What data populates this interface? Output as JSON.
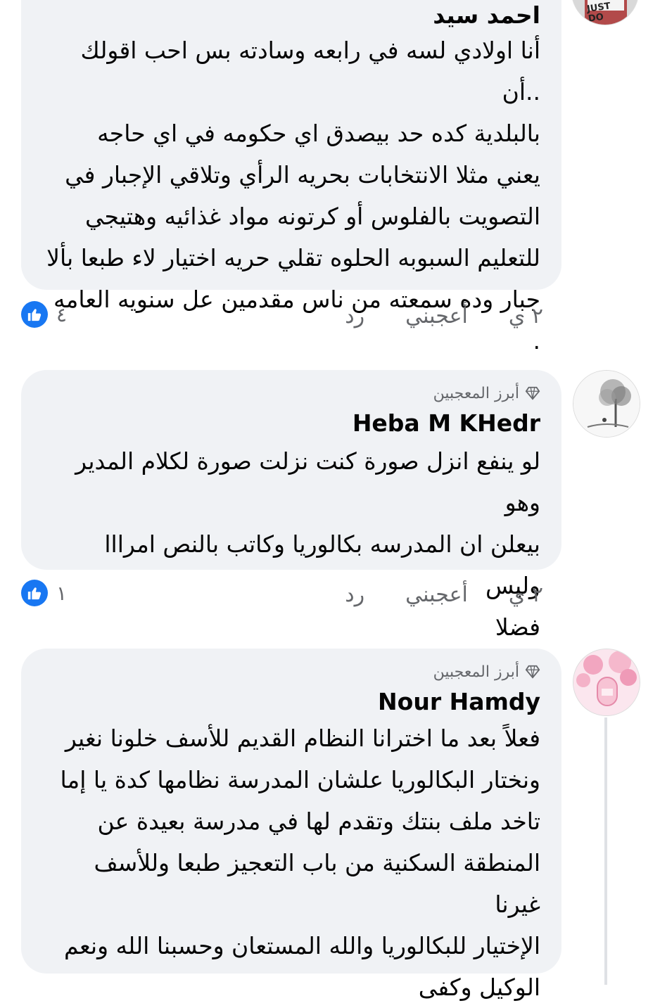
{
  "comments": [
    {
      "author": "احمد سيد",
      "top_fan_label": "",
      "avatar_text": "JUST DO",
      "lines": [
        "أنا اولادي لسه في رابعه وسادته بس احب اقولك ..أن",
        "بالبلدية كده حد بيصدق اي حكومه في اي حاجه",
        "يعني مثلا الانتخابات بحريه الرأي وتلاقي الإجبار في",
        "التصويت بالفلوس أو كرتونه مواد غذائيه وهتيجي",
        "للتعليم السبوبه الحلوه تقلي حريه اختيار لاء طبعا بألا",
        "جبار وده سمعته من ناس مقدمين عل سنويه العامه ."
      ],
      "time": "٢ ي",
      "like_label": "أعجبني",
      "reply_label": "رد",
      "reaction_count": "٤"
    },
    {
      "author": "Heba M KHedr",
      "top_fan_label": "أبرز المعجبين",
      "lines": [
        "لو ينفع انزل صورة كنت نزلت صورة لكلام المدير وهو",
        "بيعلن ان المدرسه بكالوريا وكاتب بالنص امرااا وليس",
        "فضلا"
      ],
      "time": "٢ ي",
      "like_label": "أعجبني",
      "reply_label": "رد",
      "reaction_count": "١"
    },
    {
      "author": "Nour Hamdy",
      "top_fan_label": "أبرز المعجبين",
      "lines": [
        "فعلاً بعد ما اخترانا النظام القديم للأسف خلونا نغير",
        "ونختار البكالوريا علشان المدرسة نظامها كدة يا إما",
        "تاخد ملف بنتك وتقدم لها في مدرسة بعيدة عن",
        "المنطقة السكنية من باب التعجيز طبعا وللأسف غيرنا",
        "الإختيار للبكالوريا والله المستعان وحسبنا الله ونعم",
        "الوكيل وكفى"
      ]
    }
  ],
  "colors": {
    "bubble": "#f0f2f5",
    "like_blue": "#1877f2",
    "meta_gray": "#65676b"
  },
  "icons": [
    "thumbs-up-icon",
    "diamond-icon"
  ]
}
